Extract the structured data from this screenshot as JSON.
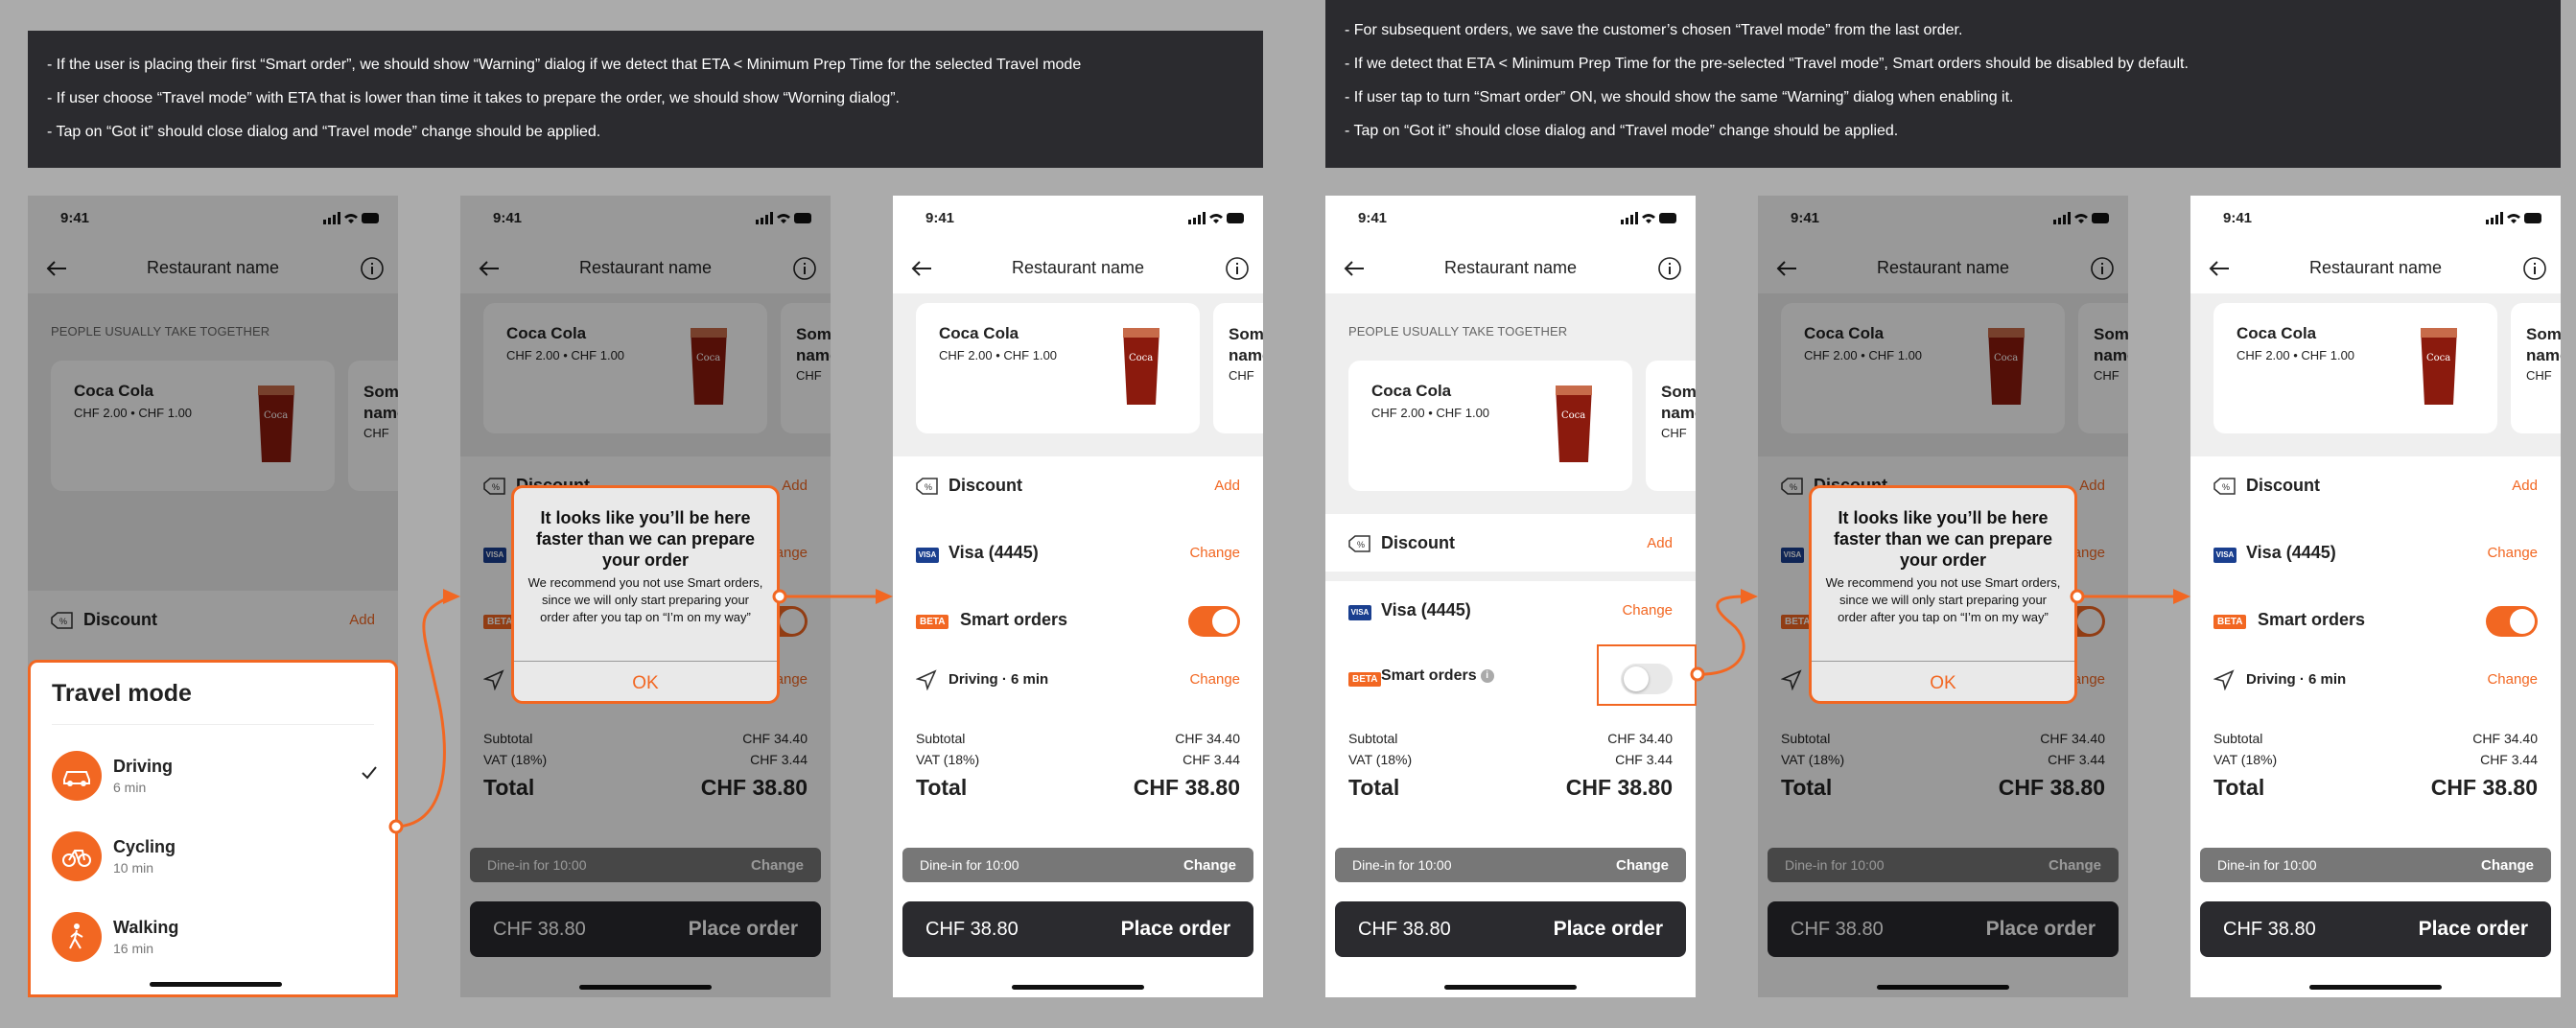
{
  "notes": {
    "left": [
      "- If the user is placing their first “Smart order”, we should show “Warning” dialog if we detect that ETA < Minimum Prep Time for the selected Travel mode",
      "- If user choose “Travel mode” with ETA that is lower than time it takes to prepare the order, we should show “Worning dialog”.",
      "- Tap on “Got it” should close dialog and “Travel mode” change should be applied."
    ],
    "right": [
      "- For subsequent orders, we save the customer’s chosen “Travel mode” from the last order.",
      "- If we detect that ETA < Minimum Prep Time for the pre-selected “Travel mode”, Smart orders should be disabled by default.",
      "- If user tap to turn “Smart order” ON, we should show the same “Warning” dialog when enabling it.",
      "- Tap on “Got it” should close dialog and “Travel mode” change should be applied."
    ]
  },
  "common": {
    "time": "9:41",
    "restaurant": "Restaurant name",
    "section_title": "PEOPLE USUALLY TAKE TOGETHER",
    "product_name": "Coca Cola",
    "product_price": "CHF 2.00 • CHF 1.00",
    "product2_name": "Some\nname",
    "product2_price": "CHF",
    "discount": "Discount",
    "add": "Add",
    "visa": "Visa (4445)",
    "visa_badge": "VISA",
    "change": "Change",
    "beta": "BETA",
    "smart_orders": "Smart orders",
    "driving": "Driving · 6 min",
    "subtotal_label": "Subtotal",
    "subtotal_value": "CHF 34.40",
    "vat_label": "VAT (18%)",
    "vat_value": "CHF 3.44",
    "total_label": "Total",
    "total_value": "CHF 38.80",
    "dinein": "Dine-in for 10:00",
    "place_amount": "CHF 38.80",
    "place_label": "Place order"
  },
  "dialog": {
    "title": "It looks like you’ll be here faster than we can prepare your order",
    "body": "We recommend you not use Smart orders, since we will only start preparing your order after you tap on “I’m on my way”",
    "ok": "OK"
  },
  "travel_mode": {
    "title": "Travel mode",
    "options": [
      {
        "name": "Driving",
        "minutes": "6 min",
        "selected": true,
        "icon": "car-icon"
      },
      {
        "name": "Cycling",
        "minutes": "10 min",
        "selected": false,
        "icon": "bicycle-icon"
      },
      {
        "name": "Walking",
        "minutes": "16 min",
        "selected": false,
        "icon": "walking-icon"
      }
    ]
  },
  "colors": {
    "accent": "#f26722",
    "dark": "#2b2b2f",
    "background": "#ababab"
  }
}
